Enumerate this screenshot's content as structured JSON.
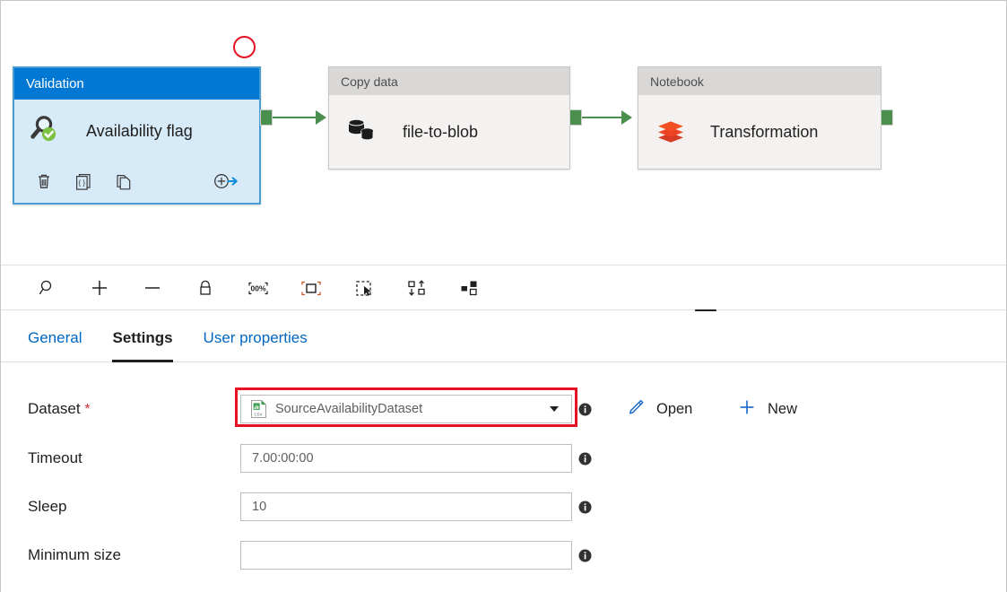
{
  "canvas": {
    "nodes": [
      {
        "type": "Validation",
        "header": "Validation",
        "title": "Availability flag",
        "icon": "magnifier-check-icon",
        "selected": true,
        "actions": [
          {
            "name": "delete-icon",
            "label": "Delete"
          },
          {
            "name": "code-icon",
            "label": "Code"
          },
          {
            "name": "duplicate-icon",
            "label": "Clone"
          },
          {
            "name": "add-output-icon",
            "label": "Add output"
          }
        ]
      },
      {
        "type": "Copy data",
        "header": "Copy data",
        "title": "file-to-blob",
        "icon": "database-copy-icon",
        "selected": false
      },
      {
        "type": "Notebook",
        "header": "Notebook",
        "title": "Transformation",
        "icon": "databricks-stack-icon",
        "selected": false
      }
    ],
    "annotation": {
      "name": "red-circle-highlight"
    },
    "colors": {
      "selected_header": "#0078d4",
      "selected_body": "#d6eaf8",
      "node_header": "#d9d8d6",
      "node_body": "#f3f2f1",
      "connector": "#4a8f4e",
      "annotation": "#e81123"
    }
  },
  "toolbar": {
    "buttons": [
      {
        "name": "zoom-search-icon",
        "label": "Search"
      },
      {
        "name": "zoom-in-icon",
        "label": "Zoom in"
      },
      {
        "name": "zoom-out-icon",
        "label": "Zoom out"
      },
      {
        "name": "lock-icon",
        "label": "Lock canvas"
      },
      {
        "name": "zoom-100-icon",
        "label": "Zoom to 100%"
      },
      {
        "name": "fit-to-screen-icon",
        "label": "Zoom to fit"
      },
      {
        "name": "marquee-select-icon",
        "label": "Select"
      },
      {
        "name": "auto-align-icon",
        "label": "Auto align"
      },
      {
        "name": "layout-icon",
        "label": "Auto layout"
      }
    ]
  },
  "tabs": [
    {
      "label": "General",
      "active": false
    },
    {
      "label": "Settings",
      "active": true
    },
    {
      "label": "User properties",
      "active": false
    }
  ],
  "form": {
    "dataset": {
      "label": "Dataset",
      "required_mark": "*",
      "value": "SourceAvailabilityDataset",
      "icon": "csv-file-icon",
      "open_label": "Open",
      "new_label": "New",
      "highlighted": true
    },
    "timeout": {
      "label": "Timeout",
      "value": "7.00:00:00"
    },
    "sleep": {
      "label": "Sleep",
      "value": "10"
    },
    "minimum_size": {
      "label": "Minimum size",
      "value": "",
      "placeholder": ""
    }
  }
}
